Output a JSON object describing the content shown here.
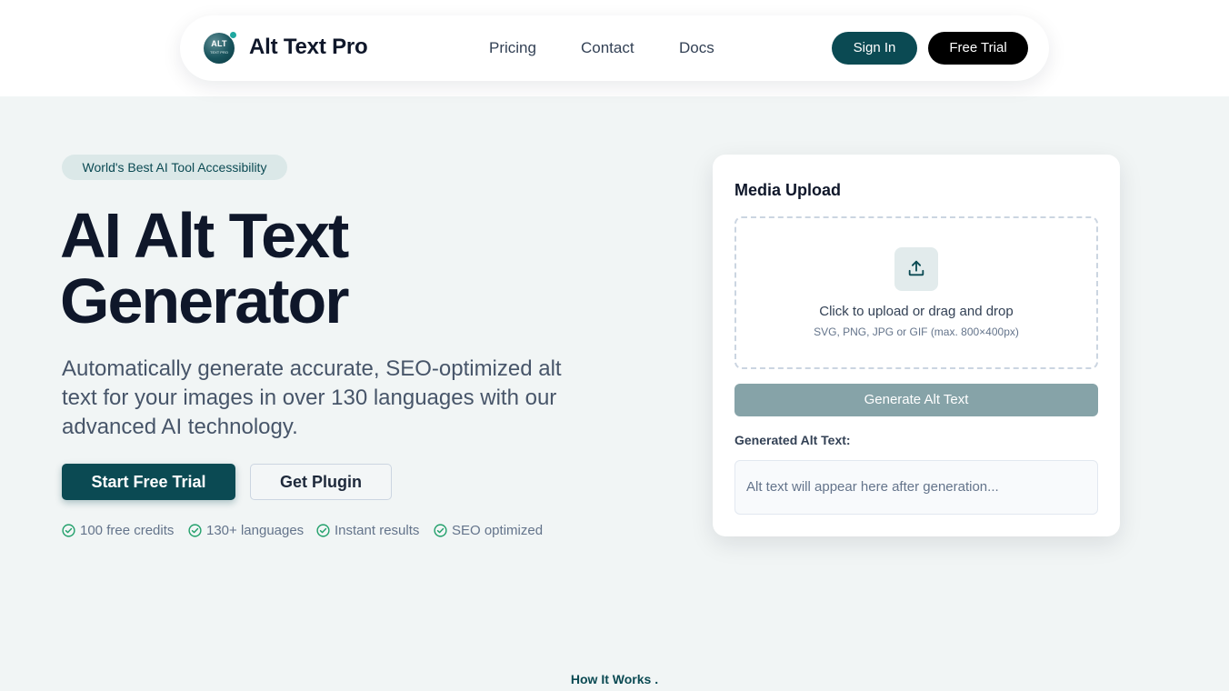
{
  "nav": {
    "logo_text": "ALT",
    "logo_subtext": "TEXT PRO",
    "brand": "Alt Text Pro",
    "links": [
      "Pricing",
      "Contact",
      "Docs"
    ],
    "sign_in": "Sign In",
    "free_trial": "Free Trial"
  },
  "hero": {
    "badge": "World's Best AI Tool Accessibility",
    "title_line1": "AI Alt Text",
    "title_line2": "Generator",
    "description": "Automatically generate accurate, SEO-optimized alt text for your images in over 130 languages with our advanced AI technology.",
    "primary_cta": "Start Free Trial",
    "secondary_cta": "Get Plugin",
    "features": [
      "100 free credits",
      "130+ languages",
      "Instant results",
      "SEO optimized"
    ]
  },
  "upload": {
    "title": "Media Upload",
    "drop_text": "Click to upload or drag and drop",
    "drop_hint": "SVG, PNG, JPG or GIF (max. 800×400px)",
    "generate_button": "Generate Alt Text",
    "output_label": "Generated Alt Text:",
    "output_placeholder": "Alt text will appear here after generation..."
  },
  "section": {
    "how_it_works": "How It Works ."
  },
  "colors": {
    "primary": "#0b4a53",
    "check": "#22a06b",
    "background": "#f1f5f5",
    "generate_disabled": "#86a3a8"
  },
  "icons": {
    "logo": "alt-text-pro-logo",
    "upload": "upload-icon",
    "feature_check": "check-circle-icon"
  }
}
